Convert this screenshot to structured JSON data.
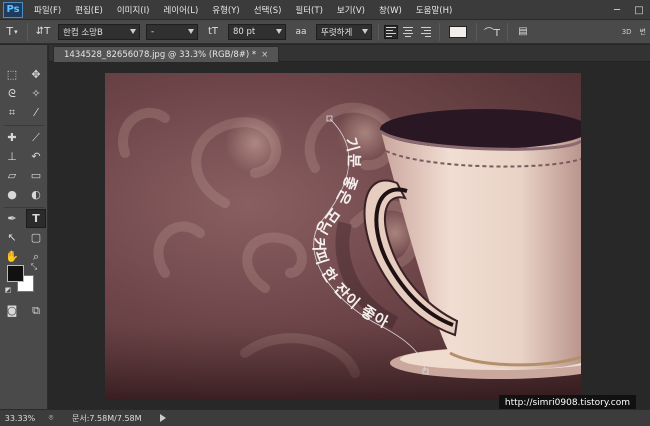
{
  "app": {
    "logo": "Ps"
  },
  "menu": [
    "파일(F)",
    "편집(E)",
    "이미지(I)",
    "레이어(L)",
    "유형(Y)",
    "선택(S)",
    "필터(T)",
    "보기(V)",
    "창(W)",
    "도움말(H)"
  ],
  "options": {
    "font_family": "한컴 소망B",
    "font_style": "-",
    "font_size": "80 pt",
    "anti_alias": "뚜렷하게",
    "text_color": "#f2eeec",
    "right_label_1": "3D",
    "right_label_2": "변"
  },
  "document": {
    "tab_label": "1434528_82656078.jpg @ 33.3% (RGB/8#) *",
    "close_glyph": "×"
  },
  "canvas_text": {
    "path_text": "기분 좋은 모닝 커피 한 잔이 좋아",
    "color": "#f4f0ee"
  },
  "status": {
    "zoom": "33.33%",
    "doc_info": "문서:7.58M/7.58M"
  },
  "watermark": "http://simri0908.tistory.com",
  "colors": {
    "foreground": "#111111",
    "background": "#ffffff"
  },
  "icons": {
    "tools": [
      "move-icon",
      "marquee-icon",
      "lasso-icon",
      "quick-select-icon",
      "crop-icon",
      "eyedropper-icon",
      "healing-icon",
      "brush-icon",
      "stamp-icon",
      "history-brush-icon",
      "eraser-icon",
      "gradient-icon",
      "blur-icon",
      "dodge-icon",
      "pen-icon",
      "type-icon",
      "path-select-icon",
      "shape-icon",
      "hand-icon",
      "zoom-icon"
    ]
  }
}
